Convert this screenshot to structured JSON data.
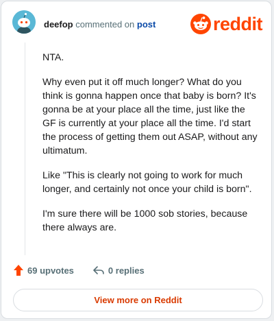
{
  "comment": {
    "username": "deefop",
    "action_text": "commented on",
    "post_link": "post",
    "paragraphs": [
      "NTA.",
      "Why even put it off much longer? What do you think is gonna happen once that baby is born? It's gonna be at your place all the time, just like the GF is currently at your place all the time. I'd start the process of getting them out ASAP, without any ultimatum.",
      "Like \"This is clearly not going to work for much longer, and certainly not once your child is born\".",
      "I'm sure there will be 1000 sob stories, because there always are."
    ]
  },
  "logo": {
    "word": "reddit",
    "icon": "reddit-snoo-icon"
  },
  "actions": {
    "upvotes_label": "69 upvotes",
    "upvote_icon": "upvote-arrow-icon",
    "replies_label": "0 replies",
    "reply_icon": "reply-arrow-icon"
  },
  "footer": {
    "view_more_label": "View more on Reddit"
  },
  "colors": {
    "brand": "#ff4500",
    "link": "#0a4aa8",
    "avatar": "#5ab8d6"
  }
}
